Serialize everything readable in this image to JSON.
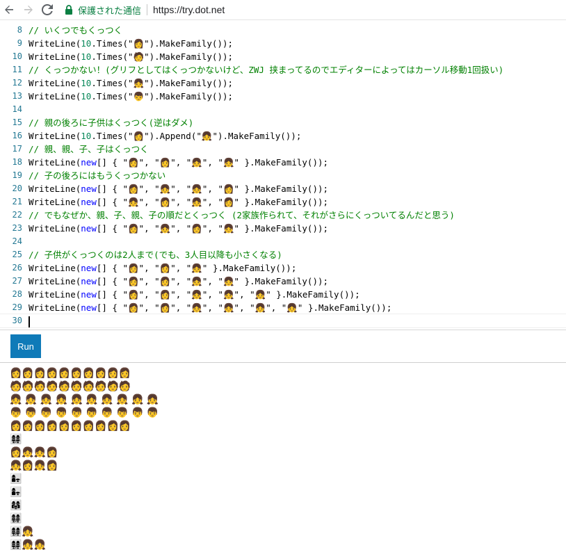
{
  "browser": {
    "secure_label": "保護された通信",
    "url": "https://try.dot.net"
  },
  "editor": {
    "lines": [
      {
        "n": "8",
        "tokens": [
          {
            "t": "// いくつでもくっつく",
            "c": "comment"
          }
        ]
      },
      {
        "n": "9",
        "tokens": [
          {
            "t": "WriteLine(",
            "c": "plain"
          },
          {
            "t": "10",
            "c": "num"
          },
          {
            "t": ".Times(\"👩\").MakeFamily());",
            "c": "plain"
          }
        ]
      },
      {
        "n": "10",
        "tokens": [
          {
            "t": "WriteLine(",
            "c": "plain"
          },
          {
            "t": "10",
            "c": "num"
          },
          {
            "t": ".Times(\"🧑\").MakeFamily());",
            "c": "plain"
          }
        ]
      },
      {
        "n": "11",
        "tokens": [
          {
            "t": "// くっつかない！(グリフとしてはくっつかないけど、ZWJ 挟まってるのでエディターによってはカーソル移動1回扱い)",
            "c": "comment"
          }
        ]
      },
      {
        "n": "12",
        "tokens": [
          {
            "t": "WriteLine(",
            "c": "plain"
          },
          {
            "t": "10",
            "c": "num"
          },
          {
            "t": ".Times(\"👧\").MakeFamily());",
            "c": "plain"
          }
        ]
      },
      {
        "n": "13",
        "tokens": [
          {
            "t": "WriteLine(",
            "c": "plain"
          },
          {
            "t": "10",
            "c": "num"
          },
          {
            "t": ".Times(\"👦\").MakeFamily());",
            "c": "plain"
          }
        ]
      },
      {
        "n": "14",
        "tokens": []
      },
      {
        "n": "15",
        "tokens": [
          {
            "t": "// 親の後ろに子供はくっつく(逆はダメ)",
            "c": "comment"
          }
        ]
      },
      {
        "n": "16",
        "tokens": [
          {
            "t": "WriteLine(",
            "c": "plain"
          },
          {
            "t": "10",
            "c": "num"
          },
          {
            "t": ".Times(\"👩\").Append(\"👧\").MakeFamily());",
            "c": "plain"
          }
        ]
      },
      {
        "n": "17",
        "tokens": [
          {
            "t": "// 親、親、子、子はくっつく",
            "c": "comment"
          }
        ]
      },
      {
        "n": "18",
        "tokens": [
          {
            "t": "WriteLine(",
            "c": "plain"
          },
          {
            "t": "new",
            "c": "kw"
          },
          {
            "t": "[] { \"👩\", \"👩\", \"👧\", \"👧\" }.MakeFamily());",
            "c": "plain"
          }
        ]
      },
      {
        "n": "19",
        "tokens": [
          {
            "t": "// 子の後ろにはもうくっつかない",
            "c": "comment"
          }
        ]
      },
      {
        "n": "20",
        "tokens": [
          {
            "t": "WriteLine(",
            "c": "plain"
          },
          {
            "t": "new",
            "c": "kw"
          },
          {
            "t": "[] { \"👩\", \"👧\", \"👧\", \"👩\" }.MakeFamily());",
            "c": "plain"
          }
        ]
      },
      {
        "n": "21",
        "tokens": [
          {
            "t": "WriteLine(",
            "c": "plain"
          },
          {
            "t": "new",
            "c": "kw"
          },
          {
            "t": "[] { \"👧\", \"👩\", \"👧\", \"👩\" }.MakeFamily());",
            "c": "plain"
          }
        ]
      },
      {
        "n": "22",
        "tokens": [
          {
            "t": "// でもなぜか、親、子、親、子の順だとくっつく (2家族作られて、それがさらにくっついてるんだと思う)",
            "c": "comment"
          }
        ]
      },
      {
        "n": "23",
        "tokens": [
          {
            "t": "WriteLine(",
            "c": "plain"
          },
          {
            "t": "new",
            "c": "kw"
          },
          {
            "t": "[] { \"👩\", \"👧\", \"👩\", \"👧\" }.MakeFamily());",
            "c": "plain"
          }
        ]
      },
      {
        "n": "24",
        "tokens": []
      },
      {
        "n": "25",
        "tokens": [
          {
            "t": "// 子供がくっつくのは2人まで(でも、3人目以降も小さくなる)",
            "c": "comment"
          }
        ]
      },
      {
        "n": "26",
        "tokens": [
          {
            "t": "WriteLine(",
            "c": "plain"
          },
          {
            "t": "new",
            "c": "kw"
          },
          {
            "t": "[] { \"👩\", \"👩\", \"👧\" }.MakeFamily());",
            "c": "plain"
          }
        ]
      },
      {
        "n": "27",
        "tokens": [
          {
            "t": "WriteLine(",
            "c": "plain"
          },
          {
            "t": "new",
            "c": "kw"
          },
          {
            "t": "[] { \"👩\", \"👩\", \"👧\", \"👧\" }.MakeFamily());",
            "c": "plain"
          }
        ]
      },
      {
        "n": "28",
        "tokens": [
          {
            "t": "WriteLine(",
            "c": "plain"
          },
          {
            "t": "new",
            "c": "kw"
          },
          {
            "t": "[] { \"👩\", \"👩\", \"👧\", \"👧\", \"👧\" }.MakeFamily());",
            "c": "plain"
          }
        ]
      },
      {
        "n": "29",
        "tokens": [
          {
            "t": "WriteLine(",
            "c": "plain"
          },
          {
            "t": "new",
            "c": "kw"
          },
          {
            "t": "[] { \"👩\", \"👩\", \"👧\", \"👧\", \"👧\", \"👧\" }.MakeFamily());",
            "c": "plain"
          }
        ]
      },
      {
        "n": "30",
        "tokens": []
      }
    ]
  },
  "run_label": "Run",
  "output": [
    "👩‍👩‍👩‍👩‍👩‍👩‍👩‍👩‍👩‍👩",
    "🧑‍🧑‍🧑‍🧑‍🧑‍🧑‍🧑‍🧑‍🧑‍🧑",
    "👧 👧 👧 👧 👧 👧 👧 👧 👧 👧",
    "👦 👦 👦 👦 👦 👦 👦 👦 👦 👦",
    "👩‍👩‍👩‍👩‍👩‍👩‍👩‍👩‍👩‍👩",
    "👩‍👩‍👧‍👧",
    "👩👧👧👩",
    "👧👩👧👩",
    "👩‍👧",
    "👩‍👧",
    "👩‍👩‍👧",
    "👩‍👩‍👧‍👧",
    "👩‍👩‍👧‍👧‍👧",
    "👩‍👩‍👧‍👧‍👧‍👧"
  ]
}
